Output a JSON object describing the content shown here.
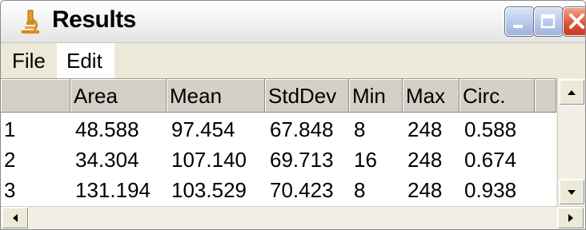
{
  "window": {
    "title": "Results",
    "icon": "microscope-icon",
    "controls": [
      "minimize-icon",
      "maximize-icon",
      "close-icon"
    ]
  },
  "menu": {
    "items": [
      {
        "label": "File"
      },
      {
        "label": "Edit"
      }
    ]
  },
  "table": {
    "columns": [
      "",
      "Area",
      "Mean",
      "StdDev",
      "Min",
      "Max",
      "Circ.",
      ""
    ],
    "rows": [
      {
        "index": "1",
        "area": "48.588",
        "mean": "97.454",
        "stddev": "67.848",
        "min": "8",
        "max": "248",
        "circ": "0.588"
      },
      {
        "index": "2",
        "area": "34.304",
        "mean": "107.140",
        "stddev": "69.713",
        "min": "16",
        "max": "248",
        "circ": "0.674"
      },
      {
        "index": "3",
        "area": "131.194",
        "mean": "103.529",
        "stddev": "70.423",
        "min": "8",
        "max": "248",
        "circ": "0.938"
      }
    ]
  },
  "scrollbars": {
    "vertical": [
      "up-arrow-icon",
      "down-arrow-icon"
    ],
    "horizontal": [
      "left-arrow-icon",
      "right-arrow-icon"
    ]
  },
  "colors": {
    "window_bg": "#ece9d8",
    "header_bg": "#d4d0c8",
    "close_button": "#e0563a",
    "button_blue": "#b7c8ec"
  }
}
